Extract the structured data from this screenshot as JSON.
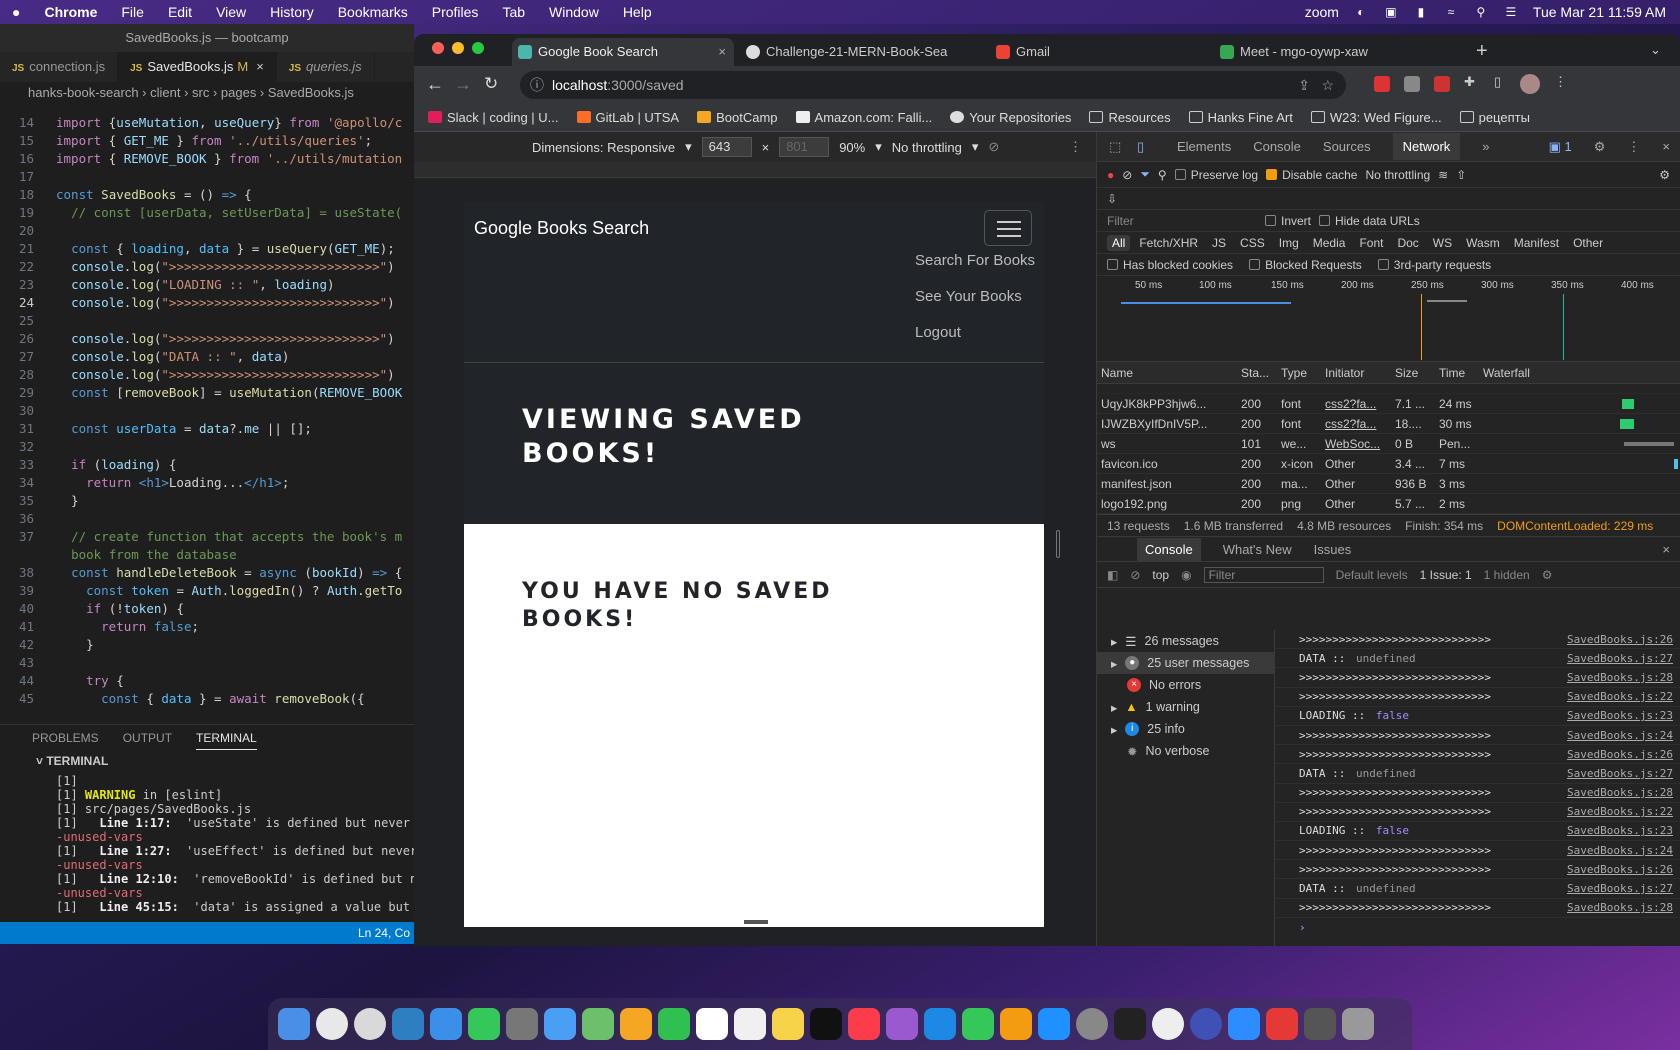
{
  "menubar": {
    "app": "Chrome",
    "items": [
      "File",
      "Edit",
      "View",
      "History",
      "Bookmarks",
      "Profiles",
      "Tab",
      "Window",
      "Help"
    ],
    "status": [
      "zoom"
    ],
    "datetime": "Tue Mar 21  11:59 AM"
  },
  "vscode": {
    "title": "SavedBooks.js — bootcamp",
    "tabs": [
      {
        "label": "connection.js"
      },
      {
        "label": "SavedBooks.js",
        "flag": "M"
      },
      {
        "label": "queries.js"
      }
    ],
    "breadcrumb": "hanks-book-search  ›  client  ›  src  ›  pages  ›  SavedBooks.js",
    "panel_tabs": [
      "PROBLEMS",
      "OUTPUT",
      "TERMINAL"
    ],
    "terminal_title": "TERMINAL",
    "status": "Ln 24, Co"
  },
  "chrome": {
    "tabs": [
      {
        "label": "Google Book Search"
      },
      {
        "label": "Challenge-21-MERN-Book-Sea"
      },
      {
        "label": "Gmail"
      },
      {
        "label": "Meet - mgo-oywp-xaw"
      }
    ],
    "url_host": "localhost",
    "url_path": ":3000/saved",
    "bookmarks": [
      "Slack | coding | U...",
      "GitLab | UTSA",
      "BootCamp",
      "Amazon.com: Falli...",
      "Your Repositories",
      "Resources",
      "Hanks Fine Art",
      "W23: Wed Figure...",
      "рецепты"
    ],
    "device": {
      "dimensions": "Dimensions: Responsive",
      "width": "643",
      "height": "801",
      "zoom": "90%",
      "throttle": "No throttling"
    }
  },
  "page": {
    "brand": "Google Books Search",
    "nav": [
      "Search For Books",
      "See Your Books",
      "Logout"
    ],
    "hero_title": "Viewing saved books!",
    "empty_message": "You have no saved books!"
  },
  "devtools": {
    "tabs": [
      "Elements",
      "Console",
      "Sources",
      "Network"
    ],
    "active_tab": "Network",
    "issues_badge": "1",
    "preserve_log": "Preserve log",
    "disable_cache": "Disable cache",
    "throttle": "No throttling",
    "filter_placeholder": "Filter",
    "invert": "Invert",
    "hide_data_urls": "Hide data URLs",
    "types": [
      "All",
      "Fetch/XHR",
      "JS",
      "CSS",
      "Img",
      "Media",
      "Font",
      "Doc",
      "WS",
      "Wasm",
      "Manifest",
      "Other"
    ],
    "blocked": [
      "Has blocked cookies",
      "Blocked Requests",
      "3rd-party requests"
    ],
    "ticks": [
      "50 ms",
      "100 ms",
      "150 ms",
      "200 ms",
      "250 ms",
      "300 ms",
      "350 ms",
      "400 ms"
    ],
    "columns": [
      "Name",
      "Sta...",
      "Type",
      "Initiator",
      "Size",
      "Time",
      "Waterfall"
    ],
    "rows": [
      {
        "name": "UqyJK8kPP3hjw6...",
        "status": "200",
        "type": "font",
        "initiator": "css2?fa...",
        "size": "7.1 ...",
        "time": "24 ms"
      },
      {
        "name": "IJWZBXyIfDnIV5P...",
        "status": "200",
        "type": "font",
        "initiator": "css2?fa...",
        "size": "18....",
        "time": "30 ms"
      },
      {
        "name": "ws",
        "status": "101",
        "type": "we...",
        "initiator": "WebSoc...",
        "size": "0 B",
        "time": "Pen..."
      },
      {
        "name": "favicon.ico",
        "status": "200",
        "type": "x-icon",
        "initiator": "Other",
        "size": "3.4 ...",
        "time": "7 ms"
      },
      {
        "name": "manifest.json",
        "status": "200",
        "type": "ma...",
        "initiator": "Other",
        "size": "936 B",
        "time": "3 ms"
      },
      {
        "name": "logo192.png",
        "status": "200",
        "type": "png",
        "initiator": "Other",
        "size": "5.7 ...",
        "time": "2 ms"
      }
    ],
    "summary": {
      "requests": "13 requests",
      "transferred": "1.6 MB transferred",
      "resources": "4.8 MB resources",
      "finish": "Finish: 354 ms",
      "dcl": "DOMContentLoaded: 229 ms"
    },
    "drawer_tabs": [
      "Console",
      "What's New",
      "Issues"
    ],
    "console_bar": {
      "context": "top",
      "filter": "Filter",
      "levels": "Default levels",
      "issues": "1 Issue:  1",
      "hidden": "1 hidden"
    },
    "sidebar": [
      "26 messages",
      "25 user messages",
      "No errors",
      "1 warning",
      "25 info",
      "No verbose"
    ],
    "log": [
      {
        "msg": ">>>>>>>>>>>>>>>>>>>>>>>>>>>>>",
        "src": "SavedBooks.js:26"
      },
      {
        "msg": "DATA :: ",
        "val": "undefined",
        "kind": "und",
        "src": "SavedBooks.js:27"
      },
      {
        "msg": ">>>>>>>>>>>>>>>>>>>>>>>>>>>>>",
        "src": "SavedBooks.js:28"
      },
      {
        "msg": ">>>>>>>>>>>>>>>>>>>>>>>>>>>>>",
        "src": "SavedBooks.js:22"
      },
      {
        "msg": "LOADING :: ",
        "val": "false",
        "kind": "bool",
        "src": "SavedBooks.js:23"
      },
      {
        "msg": ">>>>>>>>>>>>>>>>>>>>>>>>>>>>>",
        "src": "SavedBooks.js:24"
      },
      {
        "msg": ">>>>>>>>>>>>>>>>>>>>>>>>>>>>>",
        "src": "SavedBooks.js:26"
      },
      {
        "msg": "DATA :: ",
        "val": "undefined",
        "kind": "und",
        "src": "SavedBooks.js:27"
      },
      {
        "msg": ">>>>>>>>>>>>>>>>>>>>>>>>>>>>>",
        "src": "SavedBooks.js:28"
      },
      {
        "msg": ">>>>>>>>>>>>>>>>>>>>>>>>>>>>>",
        "src": "SavedBooks.js:22"
      },
      {
        "msg": "LOADING :: ",
        "val": "false",
        "kind": "bool",
        "src": "SavedBooks.js:23"
      },
      {
        "msg": ">>>>>>>>>>>>>>>>>>>>>>>>>>>>>",
        "src": "SavedBooks.js:24"
      },
      {
        "msg": ">>>>>>>>>>>>>>>>>>>>>>>>>>>>>",
        "src": "SavedBooks.js:26"
      },
      {
        "msg": "DATA :: ",
        "val": "undefined",
        "kind": "und",
        "src": "SavedBooks.js:27"
      },
      {
        "msg": ">>>>>>>>>>>>>>>>>>>>>>>>>>>>>",
        "src": "SavedBooks.js:28"
      }
    ]
  },
  "colors": {
    "accent": "#007acc",
    "devtools_warn": "#f39c12",
    "dcl": "#f39c12"
  }
}
